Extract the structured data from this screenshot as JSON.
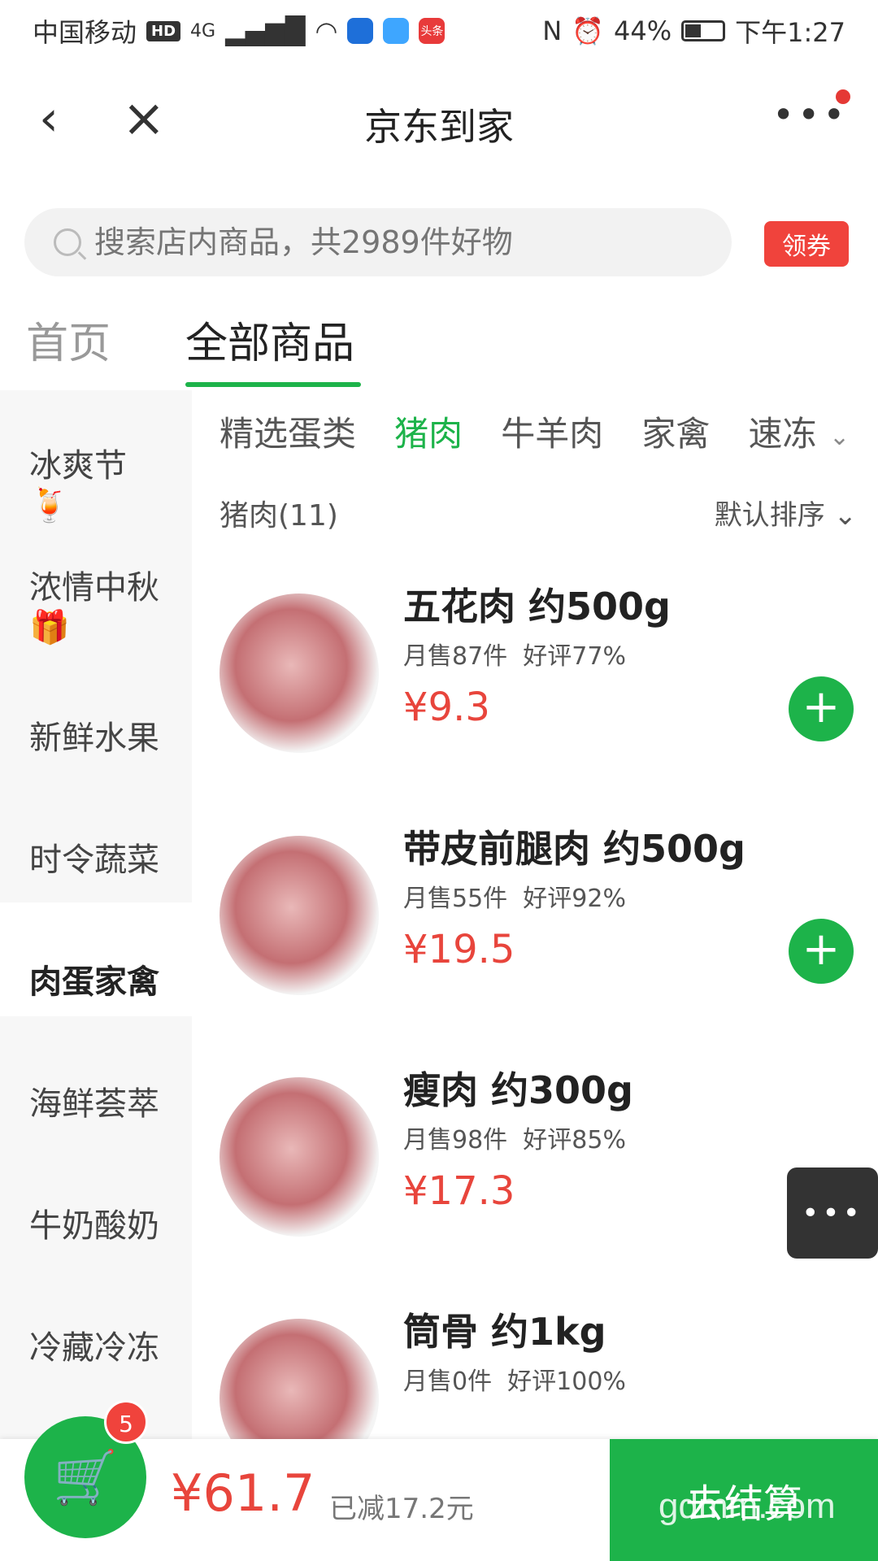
{
  "status_bar": {
    "carrier": "中国移动",
    "hd": "HD",
    "network": "4G",
    "app_badge": "头条",
    "battery": "44%",
    "battery_level": 0.44,
    "time": "下午1:27"
  },
  "nav": {
    "title": "京东到家",
    "back_icon": "‹",
    "close_icon": "×",
    "more_icon": "•••"
  },
  "search": {
    "placeholder": "搜索店内商品，共2989件好物",
    "coupon_label": "领券"
  },
  "store_tabs": [
    {
      "label": "首页"
    },
    {
      "label": "全部商品"
    }
  ],
  "sidebar": {
    "items": [
      {
        "label": "冰爽节",
        "emoji": "🍹"
      },
      {
        "label": "浓情中秋",
        "emoji": "🎁"
      },
      {
        "label": "新鲜水果"
      },
      {
        "label": "时令蔬菜"
      },
      {
        "label": "肉蛋家禽"
      },
      {
        "label": "海鲜荟萃"
      },
      {
        "label": "牛奶酸奶"
      },
      {
        "label": "冷藏冷冻"
      }
    ]
  },
  "subcategories": {
    "items": [
      "精选蛋类",
      "猪肉",
      "牛羊肉",
      "家禽",
      "速冻"
    ],
    "active": "猪肉",
    "more_icon": "⌄"
  },
  "list": {
    "header": "猪肉(11)",
    "sort": "默认排序 ⌄"
  },
  "products": [
    {
      "name": "五花肉 约500g",
      "sales": "月售87件",
      "rating": "好评77%",
      "price": "¥9.3"
    },
    {
      "name": "带皮前腿肉 约500g",
      "sales": "月售55件",
      "rating": "好评92%",
      "price": "¥19.5"
    },
    {
      "name": "瘦肉 约300g",
      "sales": "月售98件",
      "rating": "好评85%",
      "price": "¥17.3"
    },
    {
      "name": "筒骨 约1kg",
      "sales": "月售0件",
      "rating": "好评100%",
      "price": ""
    }
  ],
  "float_more_icon": "•••",
  "cart": {
    "badge": "5",
    "total": "¥61.7",
    "discount": "已减17.2元",
    "checkout": "去结算",
    "cart_icon": "🛒"
  },
  "watermark": "gdmm.com",
  "colors": {
    "accent_green": "#1db34a",
    "price_red": "#e8453c",
    "badge_red": "#f0433c"
  }
}
